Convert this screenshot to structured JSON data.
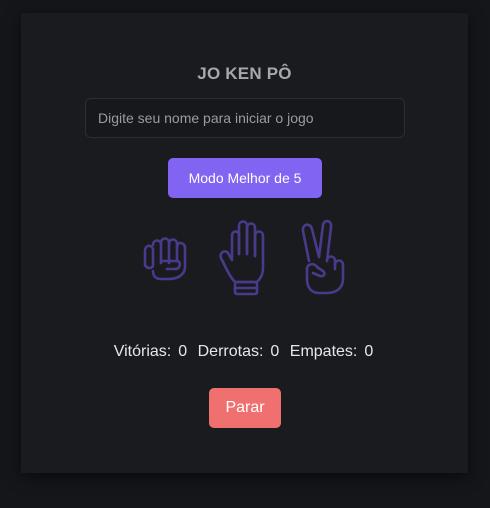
{
  "game": {
    "title": "JO KEN PÔ",
    "name_placeholder": "Digite seu nome para iniciar o jogo",
    "name_value": "",
    "mode_button_label": "Modo Melhor de 5",
    "choices": [
      {
        "name": "rock",
        "icon": "fist-icon"
      },
      {
        "name": "paper",
        "icon": "open-hand-icon"
      },
      {
        "name": "scissors",
        "icon": "victory-hand-icon"
      }
    ],
    "icon_color": "#4a3a8c",
    "score": {
      "wins_label": "Vitórias:",
      "wins": "0",
      "losses_label": "Derrotas:",
      "losses": "0",
      "draws_label": "Empates:",
      "draws": "0"
    },
    "stop_button_label": "Parar"
  },
  "colors": {
    "accent": "#8264f2",
    "danger": "#f07070",
    "background": "#15161a",
    "card": "#1a1b1f"
  }
}
